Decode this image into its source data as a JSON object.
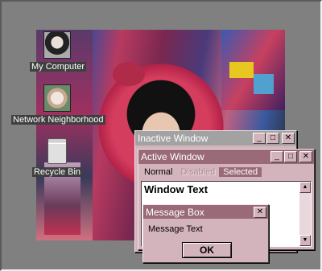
{
  "desktop": {
    "icons": [
      {
        "label": "My Computer",
        "icon": "computer-icon"
      },
      {
        "label": "Network Neighborhood",
        "icon": "network-icon"
      },
      {
        "label": "Recycle Bin",
        "icon": "recycle-bin-icon"
      }
    ]
  },
  "inactive_window": {
    "title": "Inactive Window"
  },
  "active_window": {
    "title": "Active Window",
    "menu": {
      "normal": "Normal",
      "disabled": "Disabled",
      "selected": "Selected"
    },
    "window_text": "Window Text"
  },
  "message_box": {
    "title": "Message Box",
    "text": "Message Text",
    "ok_label": "OK"
  },
  "colors": {
    "active_title": "#9a6a78",
    "inactive_title": "#a2a2a2",
    "window_face": "#d4b4bc",
    "desktop": "#808080"
  }
}
